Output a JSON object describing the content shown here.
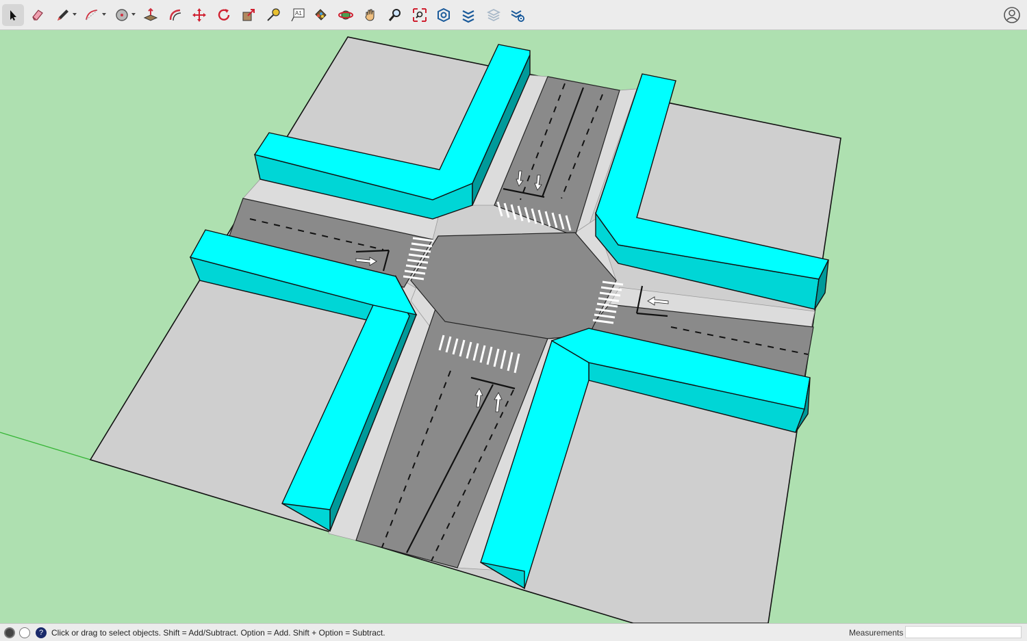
{
  "toolbar": {
    "tools": [
      {
        "name": "select-tool",
        "icon": "arrow-cursor-icon"
      },
      {
        "name": "eraser-tool",
        "icon": "eraser-icon"
      },
      {
        "name": "line-tool",
        "icon": "pencil-icon"
      },
      {
        "name": "arc-tool",
        "icon": "arc-icon"
      },
      {
        "name": "shape-tool",
        "icon": "circle-shape-icon"
      },
      {
        "name": "push-pull-tool",
        "icon": "push-pull-icon"
      },
      {
        "name": "offset-tool",
        "icon": "offset-icon"
      },
      {
        "name": "move-tool",
        "icon": "move-arrows-icon"
      },
      {
        "name": "rotate-tool",
        "icon": "rotate-icon"
      },
      {
        "name": "scale-tool",
        "icon": "scale-icon"
      },
      {
        "name": "tape-measure-tool",
        "icon": "tape-measure-icon"
      },
      {
        "name": "text-tool",
        "icon": "text-label-icon"
      },
      {
        "name": "paint-bucket-tool",
        "icon": "paint-bucket-icon"
      },
      {
        "name": "orbit-tool",
        "icon": "orbit-icon"
      },
      {
        "name": "pan-tool",
        "icon": "hand-icon"
      },
      {
        "name": "zoom-tool",
        "icon": "magnifier-icon"
      },
      {
        "name": "zoom-extents-tool",
        "icon": "zoom-extents-icon"
      },
      {
        "name": "3d-warehouse-tool",
        "icon": "warehouse-icon"
      },
      {
        "name": "extension-warehouse-tool",
        "icon": "extension-icon"
      },
      {
        "name": "layout-tool",
        "icon": "layers-icon"
      },
      {
        "name": "extension-manager-tool",
        "icon": "extension-gear-icon"
      }
    ],
    "account_icon": "account-icon"
  },
  "colors": {
    "background": "#aee0b0",
    "building_top": "#00ffff",
    "building_front": "#00d6d6",
    "building_side": "#009a9a",
    "ground": "#cfcfcf",
    "sidewalk": "#dcdcdc",
    "road": "#8a8a8a",
    "axis_green": "#35b535"
  },
  "status": {
    "hint": "Click or drag to select objects. Shift = Add/Subtract. Option = Add. Shift + Option = Subtract.",
    "measurements_label": "Measurements",
    "measurements_value": ""
  }
}
